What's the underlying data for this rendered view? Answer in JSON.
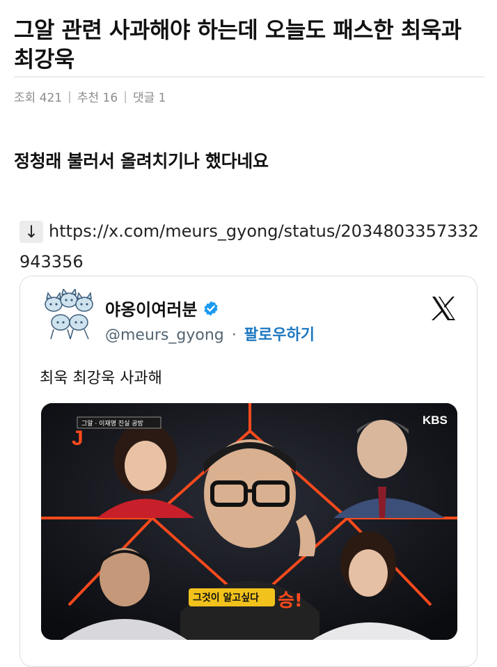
{
  "post": {
    "title": "그알 관련 사과해야 하는데 오늘도 패스한 최욱과 최강욱",
    "meta": {
      "views_label": "조회 421",
      "likes_label": "추천 16",
      "comments_label": "댓글 1"
    },
    "body_text": "정청래 불러서 올려치기나 했다네요",
    "link_arrow": "↓",
    "link_url": "https://x.com/meurs_gyong/status/2034803357332943356"
  },
  "embed": {
    "display_name": "야옹이여러분",
    "handle": "@meurs_gyong",
    "dot": "·",
    "follow_label": "팔로우하기",
    "tweet_text": "최욱 최강욱 사과해",
    "media": {
      "channel_logo": "KBS",
      "show_tag": "그알 · 이재명 진실 공방",
      "show_letter": "J",
      "caption": "그것이 알고싶다",
      "caption_suffix": "승!"
    }
  },
  "icons": {
    "verified": "verified-badge-icon",
    "x_logo": "x-logo-icon",
    "arrow": "down-arrow-icon"
  },
  "colors": {
    "accent_blue": "#1d78c1",
    "verified_blue": "#1d9bf0",
    "frame_orange": "#ff4a1c"
  }
}
